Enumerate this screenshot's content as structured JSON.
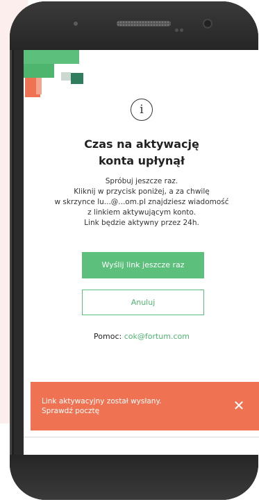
{
  "dialog": {
    "title_line1": "Czas na aktywację",
    "title_line2": "konta upłynął",
    "body": [
      "Spróbuj jeszcze raz.",
      "Kliknij w przycisk poniżej, a za chwilę",
      "w skrzynce lu...@...om.pl znajdziesz wiadomość",
      "z linkiem aktywującym konto.",
      "Link będzie aktywny przez 24h."
    ],
    "resend_button_label": "Wyślij link jeszcze raz",
    "cancel_button_label": "Anuluj",
    "help_label": "Pomoc:",
    "help_email": "cok@fortum.com"
  },
  "toast": {
    "line1": "Link aktywacyjny został wysłany.",
    "line2": "Sprawdź pocztę",
    "close_glyph": "✕"
  },
  "icons": {
    "info": "i"
  },
  "colors": {
    "accent_green": "#5dbf7c",
    "toast_orange": "#ef7352"
  }
}
